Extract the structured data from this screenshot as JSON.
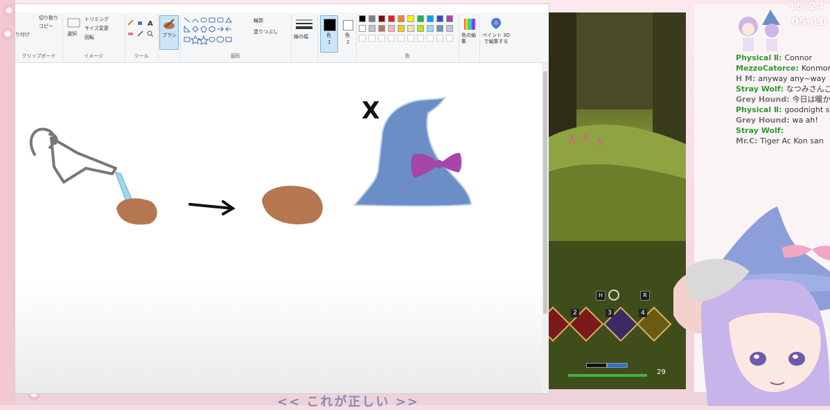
{
  "overlay": {
    "clock": "15:24",
    "date": "05/10",
    "caption": "<< これが正しい >>"
  },
  "paint": {
    "groups": {
      "clipboard": {
        "label": "クリップボード",
        "cut": "切り取り",
        "copy": "コピー",
        "paste": "り付け"
      },
      "image": {
        "label": "イメージ",
        "select": "選択",
        "crop": "トリミング",
        "resize": "サイズ変更",
        "rotate": "回転"
      },
      "tools": {
        "label": "ツール"
      },
      "brush": {
        "label": "ブラシ"
      },
      "shapes": {
        "label": "図形",
        "outline": "輪郭",
        "fill": "塗りつぶし"
      },
      "size": {
        "label": "線の幅"
      },
      "color1": {
        "label": "色",
        "sub": "1"
      },
      "color2": {
        "label": "色",
        "sub": "2"
      },
      "colors": {
        "label": "色"
      },
      "edit_colors": {
        "label": "色の編集"
      },
      "paint3d": {
        "label": "ペイント 3D で編集する"
      }
    },
    "palette": [
      "#000000",
      "#7f7f7f",
      "#880015",
      "#ed1c24",
      "#ff7f27",
      "#fff200",
      "#22b14c",
      "#00a2e8",
      "#3f48cc",
      "#a349a4",
      "#ffffff",
      "#c3c3c3",
      "#b97a57",
      "#ffaec9",
      "#ffc90e",
      "#efe4b0",
      "#b5e61d",
      "#99d9ea",
      "#7092be",
      "#c8bfe7"
    ],
    "drawing": {
      "mark_x": "X"
    }
  },
  "game": {
    "hud_keys": [
      "H",
      "R"
    ],
    "skill_numbers": [
      "2",
      "3",
      "4"
    ],
    "level": "29"
  },
  "chat": {
    "messages": [
      {
        "name": "Physical Ⅱ",
        "text": "Connor",
        "name_color": "green"
      },
      {
        "name": "MezzoCatorce",
        "text": "Konmori!",
        "name_color": "green"
      },
      {
        "name": "H M",
        "text": "anyway any~way",
        "name_color": "gray"
      },
      {
        "name": "Stray Wolf",
        "text": "なつみさんごめんなさい まだまだ序盤なので早く寝てアーカイブみます",
        "name_color": "green"
      },
      {
        "name": "Grey Hound",
        "text": "今日は暖かくありませんか？",
        "name_color": "gray"
      },
      {
        "name": "Physical Ⅱ",
        "text": "goodnight stray wolf",
        "name_color": "green"
      },
      {
        "name": "Grey Hound",
        "text": "wa ah!",
        "name_color": "gray"
      },
      {
        "name": "Stray Wolf",
        "text": "",
        "name_color": "green"
      },
      {
        "name": "Mr.C",
        "text": "Tiger Ac Kon san",
        "name_color": "gray"
      }
    ]
  },
  "colors": {
    "accent_blue": "#6c8ec6",
    "brown": "#b57750",
    "bow_purple": "#a646a8",
    "caption": "#7c8fb0"
  }
}
